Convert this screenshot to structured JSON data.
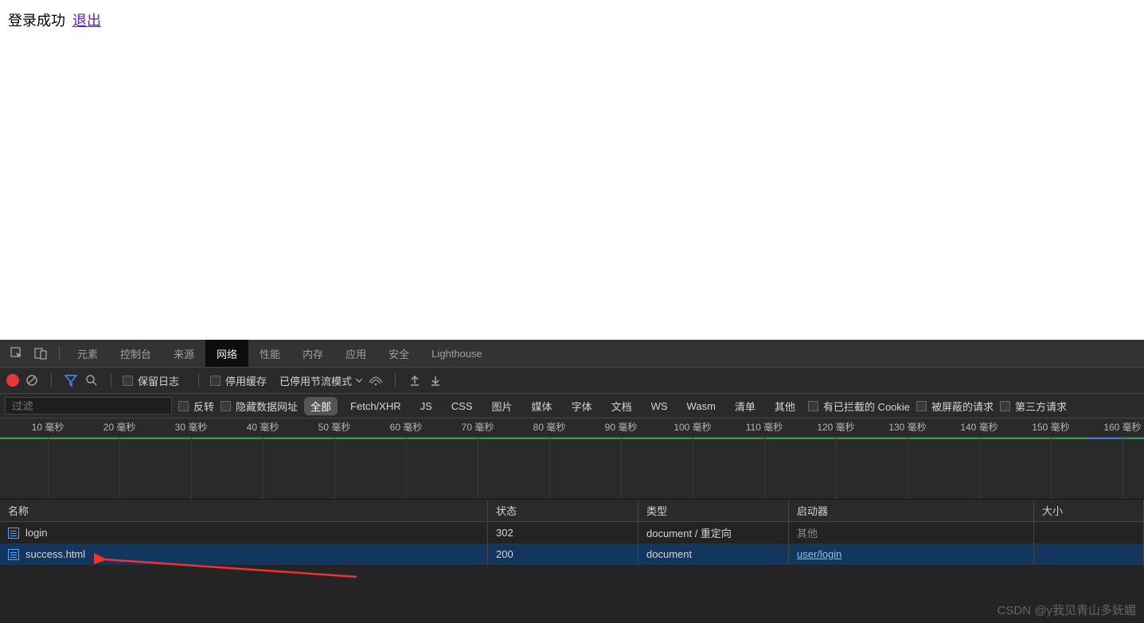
{
  "page": {
    "success_text": "登录成功",
    "logout_link": "退出"
  },
  "tabs": {
    "elements": "元素",
    "console": "控制台",
    "sources": "来源",
    "network": "网络",
    "performance": "性能",
    "memory": "内存",
    "application": "应用",
    "security": "安全",
    "lighthouse": "Lighthouse"
  },
  "toolbar": {
    "preserve_log": "保留日志",
    "disable_cache": "停用缓存",
    "throttling": "已停用节流模式"
  },
  "filterbar": {
    "filter_placeholder": "过滤",
    "invert": "反转",
    "hide_data_urls": "隐藏数据网址",
    "types": {
      "all": "全部",
      "fetch": "Fetch/XHR",
      "js": "JS",
      "css": "CSS",
      "img": "图片",
      "media": "媒体",
      "font": "字体",
      "doc": "文档",
      "ws": "WS",
      "wasm": "Wasm",
      "manifest": "清单",
      "other": "其他"
    },
    "blocked_cookies": "有已拦截的 Cookie",
    "blocked_requests": "被屏蔽的请求",
    "third_party": "第三方请求"
  },
  "ruler": [
    "10 毫秒",
    "20 毫秒",
    "30 毫秒",
    "40 毫秒",
    "50 毫秒",
    "60 毫秒",
    "70 毫秒",
    "80 毫秒",
    "90 毫秒",
    "100 毫秒",
    "110 毫秒",
    "120 毫秒",
    "130 毫秒",
    "140 毫秒",
    "150 毫秒",
    "160 毫秒"
  ],
  "table": {
    "headers": {
      "name": "名称",
      "status": "状态",
      "type": "类型",
      "initiator": "启动器",
      "size": "大小"
    },
    "rows": [
      {
        "name": "login",
        "status": "302",
        "type": "document / 重定向",
        "initiator": "其他",
        "initiator_dimmed": true,
        "size": ""
      },
      {
        "name": "success.html",
        "status": "200",
        "type": "document",
        "initiator": "user/login",
        "initiator_link": true,
        "size": ""
      }
    ]
  },
  "watermark": "CSDN @y我见青山多妩媚"
}
